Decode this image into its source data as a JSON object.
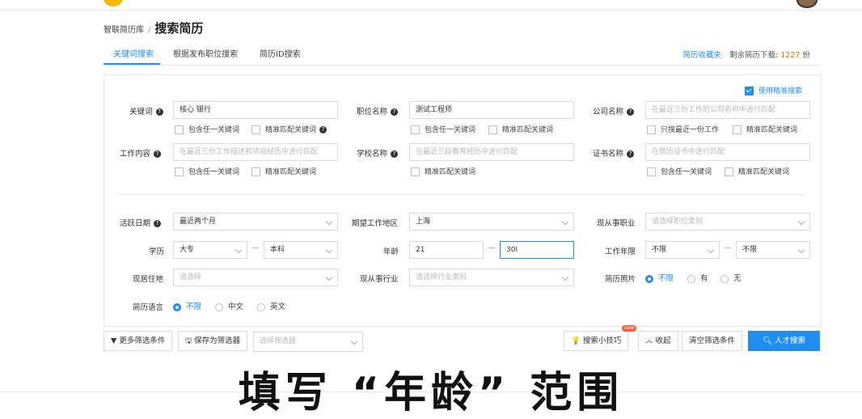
{
  "breadcrumb": {
    "parent": "智联简历库",
    "separator": "/",
    "current": "搜索简历"
  },
  "tabs": [
    {
      "label": "关键词搜索",
      "active": true
    },
    {
      "label": "根据发布职位搜索",
      "active": false
    },
    {
      "label": "简历ID搜索",
      "active": false
    }
  ],
  "header_right": {
    "favorites": "简历收藏夹",
    "remaining_label": "剩余简历下载:",
    "remaining_count": "1227",
    "remaining_unit": "份"
  },
  "precise_search": {
    "label": "使用精准搜索",
    "checked": true
  },
  "form": {
    "keyword": {
      "label": "关键词",
      "value": "核心 银行",
      "opt1": "包含任一关键词",
      "opt2": "精准匹配关键词"
    },
    "job_title": {
      "label": "职位名称",
      "value": "测试工程师",
      "opt1": "包含任一关键词",
      "opt2": "精准匹配关键词"
    },
    "company": {
      "label": "公司名称",
      "placeholder": "在最近三份工作的公司名称中进行匹配",
      "opt1": "只搜最近一份工作",
      "opt2": "精准匹配关键词"
    },
    "work_content": {
      "label": "工作内容",
      "placeholder": "在最近三份工作描述和项目经历中进行匹配",
      "opt1": "包含任一关键词",
      "opt2": "精准匹配关键词"
    },
    "school": {
      "label": "学校名称",
      "placeholder": "在最近三段教育经历中进行匹配",
      "opt1": "精准匹配关键词"
    },
    "certificate": {
      "label": "证书名称",
      "placeholder": "在简历证书中进行匹配",
      "opt1": "包含任一关键词",
      "opt2": "精准匹配关键词"
    },
    "active_date": {
      "label": "活跃日期",
      "value": "最近两个月"
    },
    "expected_area": {
      "label": "期望工作地区",
      "value": "上海"
    },
    "current_job": {
      "label": "现从事职业",
      "placeholder": "请选择职位类别"
    },
    "education": {
      "label": "学历",
      "from": "大专",
      "to": "本科"
    },
    "age": {
      "label": "年龄",
      "from": "21",
      "to": "30"
    },
    "work_years": {
      "label": "工作年限",
      "from": "不限",
      "to": "不限"
    },
    "residence": {
      "label": "现居住地",
      "placeholder": "请选择"
    },
    "industry": {
      "label": "现从事行业",
      "placeholder": "请选择行业类别"
    },
    "photo": {
      "label": "简历照片",
      "options": [
        "不限",
        "有",
        "无"
      ],
      "selected": "不限"
    },
    "language": {
      "label": "简历语言",
      "options": [
        "不限",
        "中文",
        "英文"
      ],
      "selected": "不限"
    }
  },
  "toolbar": {
    "more_filters": "更多筛选条件",
    "save_filter": "保存为筛选器",
    "select_filter_placeholder": "选择筛选器",
    "tips": "搜索小技巧",
    "tips_badge": "new",
    "collapse": "收起",
    "clear": "清空筛选条件",
    "search": "人才搜索"
  },
  "caption": "填写 “年龄” 范围",
  "colors": {
    "accent": "#1f8ef1",
    "count": "#ff6a00",
    "badge": "#ff5b3a"
  }
}
